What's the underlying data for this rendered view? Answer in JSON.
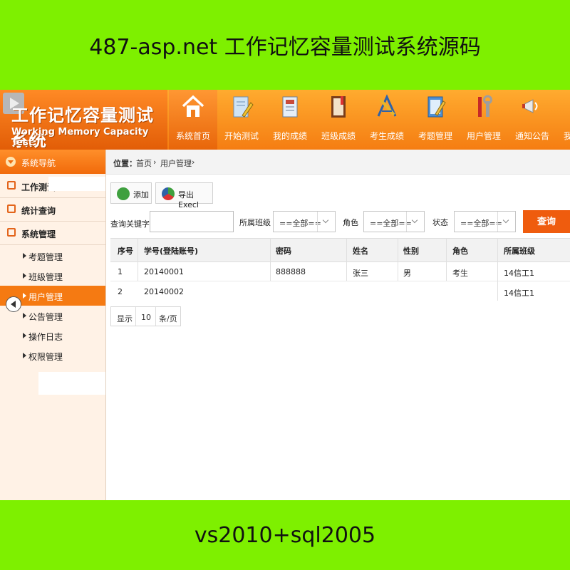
{
  "banner": {
    "top": "487-asp.net 工作记忆容量测试系统源码",
    "bottom": "vs2010+sql2005"
  },
  "logo": {
    "title_cn": "工作记忆容量测试系统",
    "title_en": "Working Memory Capacity Test"
  },
  "nav": [
    {
      "label": "系统首页",
      "icon": "home-icon",
      "active": true
    },
    {
      "label": "开始测试",
      "icon": "edit-document-icon"
    },
    {
      "label": "我的成绩",
      "icon": "scorecard-icon"
    },
    {
      "label": "班级成绩",
      "icon": "book-icon"
    },
    {
      "label": "考生成绩",
      "icon": "tools-icon"
    },
    {
      "label": "考题管理",
      "icon": "notepad-icon"
    },
    {
      "label": "用户管理",
      "icon": "wrench-icon"
    },
    {
      "label": "通知公告",
      "icon": "megaphone-icon"
    }
  ],
  "sidebar": {
    "title": "系统导航",
    "sections": [
      "工作测试",
      "统计查询",
      "系统管理"
    ],
    "items": [
      "考题管理",
      "班级管理",
      "用户管理",
      "公告管理",
      "操作日志",
      "权限管理"
    ],
    "active_item": "用户管理"
  },
  "breadcrumb": {
    "prefix": "位置：",
    "home": "首页",
    "current": "用户管理",
    "sep": "›"
  },
  "toolbar": {
    "add_label": "添加",
    "export_label": "导出Execl"
  },
  "filters": {
    "keyword_label": "查询关键字",
    "keyword_value": "",
    "class_label": "所属班级",
    "class_value": "==全部==",
    "role_label": "角色",
    "role_value": "==全部==",
    "status_label": "状态",
    "status_value": "==全部==",
    "search_label": "查询"
  },
  "table": {
    "columns": [
      "序号",
      "学号(登陆账号)",
      "密码",
      "姓名",
      "性别",
      "角色",
      "所属班级"
    ],
    "rows": [
      [
        "1",
        "20140001",
        "888888",
        "张三",
        "男",
        "考生",
        "14信工1"
      ],
      [
        "2",
        "20140002",
        "",
        "",
        "",
        "",
        "14信工1"
      ]
    ]
  },
  "pager": {
    "show_label": "显示",
    "page_size": "10",
    "unit": "条/页"
  },
  "colors": {
    "banner_bg": "#7ef000",
    "header_orange": "#f57d12",
    "active_orange": "#f57a12",
    "search_button": "#ef5c0e"
  }
}
